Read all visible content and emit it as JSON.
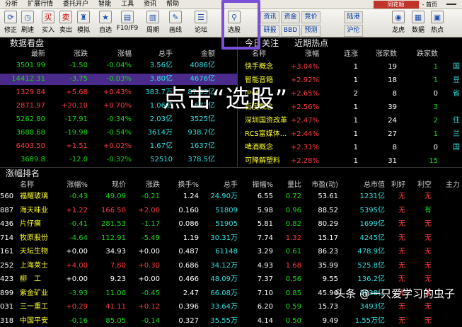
{
  "menu": {
    "items": [
      "分析",
      "扩展行情",
      "委托开户",
      "智能",
      "工具",
      "资讯",
      "帮助"
    ],
    "brand": "同花顺",
    "window_title": "- 首页"
  },
  "toolbar": {
    "buttons": [
      {
        "name": "refresh-button",
        "label": "修正",
        "icon": "⟳"
      },
      {
        "name": "clock-button",
        "label": "刷速",
        "icon": "◷"
      },
      {
        "name": "buy-button",
        "label": "买入",
        "icon": "买"
      },
      {
        "name": "sell-button",
        "label": "卖出",
        "icon": "卖"
      },
      {
        "name": "simulate-button",
        "label": "模拟",
        "icon": "♜"
      },
      {
        "name": "watchlist-button",
        "label": "自选",
        "icon": "★"
      },
      {
        "name": "f10-button",
        "label": "F10/F9",
        "icon": "▤"
      },
      {
        "name": "period-button",
        "label": "周期",
        "icon": "▥"
      },
      {
        "name": "drawline-button",
        "label": "画线",
        "icon": "✎"
      },
      {
        "name": "forum-button",
        "label": "论坛",
        "icon": "☰"
      },
      {
        "name": "stock-selector-button",
        "label": "选股",
        "icon": "⚲"
      },
      {
        "name": "longhu-button",
        "label": "龙虎",
        "icon": "◉"
      },
      {
        "name": "data-button",
        "label": "数据",
        "icon": "▦"
      },
      {
        "name": "hot-button",
        "label": "热点",
        "icon": "▣"
      }
    ],
    "grid_a": [
      "资讯",
      "资金",
      "竞价",
      "研报",
      "BBD",
      "预测"
    ],
    "grid_b": [
      "陆港",
      "沪伦"
    ]
  },
  "market": {
    "title": "数据看盘",
    "headers": [
      "最新",
      "涨跌",
      "涨幅",
      "总手",
      "金额"
    ],
    "rows": [
      {
        "cls": "dn",
        "v": [
          "3501.99",
          "-1.50",
          "-0.04%",
          "3.56亿",
          "4086亿"
        ]
      },
      {
        "cls": "dn",
        "v": [
          "14412.31",
          "-3.75",
          "-0.03%",
          "3.80亿",
          "4676亿"
        ]
      },
      {
        "cls": "up",
        "v": [
          "1329.84",
          "+5.68",
          "+0.43%",
          "383.7万",
          "87.93亿"
        ]
      },
      {
        "cls": "up",
        "v": [
          "2871.97",
          "+20.10",
          "+0.70%",
          "1.06亿",
          "1672亿"
        ]
      },
      {
        "cls": "dn",
        "v": [
          "5262.80",
          "-17.91",
          "-0.34%",
          "2.03亿",
          "3525亿"
        ]
      },
      {
        "cls": "dn",
        "v": [
          "3688.68",
          "-19.98",
          "-0.54%",
          "3614万",
          "938.7亿"
        ]
      },
      {
        "cls": "up",
        "v": [
          "6403.50",
          "+1.51",
          "+0.02%",
          "1.67亿",
          "1637亿"
        ]
      },
      {
        "cls": "dn",
        "v": [
          "3689.8",
          "-12.0",
          "-0.32%",
          "52510",
          "378.5亿"
        ]
      }
    ]
  },
  "hot": {
    "tabs": [
      "今日关注",
      "近期热点"
    ],
    "headers": [
      "名称",
      "涨幅",
      "连涨",
      "涨家数",
      "跌家数"
    ],
    "rows": [
      {
        "name": "快手概念",
        "chg": "+3.04%",
        "days": "1",
        "up": "19",
        "down": "1"
      },
      {
        "name": "智能音箱",
        "chg": "+2.92%",
        "days": "1",
        "up": "18",
        "down": "1"
      },
      {
        "name": "IPv6",
        "chg": "+2.65%",
        "days": "2",
        "up": "8",
        "down": "0"
      },
      {
        "name": "百度概念",
        "chg": "+2.56%",
        "days": "1",
        "up": "39",
        "down": "3"
      },
      {
        "name": "深圳国资改革",
        "chg": "+2.47%",
        "days": "1",
        "up": "24",
        "down": "2"
      },
      {
        "name": "RCS富媒体...",
        "chg": "+2.44%",
        "days": "1",
        "up": "27",
        "down": "1"
      },
      {
        "name": "啤酒概念",
        "chg": "+2.31%",
        "days": "1",
        "up": "8",
        "down": "0"
      },
      {
        "name": "可降解塑料",
        "chg": "+2.28%",
        "days": "1",
        "up": "31",
        "down": "15"
      }
    ],
    "edge": [
      "国",
      "豆",
      "省",
      "",
      "住",
      "兰",
      "国"
    ]
  },
  "rank": {
    "title": "涨幅排名",
    "headers": [
      "名称",
      "涨幅%",
      "现价",
      "涨跌",
      "换手%",
      "总手",
      "振幅%",
      "量比",
      "市盈(动)",
      "总市值",
      "利好",
      "利空",
      "主力"
    ],
    "rows": [
      {
        "code": "560",
        "name": "福耀玻璃",
        "chg": "-0.43",
        "price": "49.09",
        "diff": "-0.21",
        "turn": "1.24",
        "vol": "24.90万",
        "amp": "6.55",
        "vr": "0.72",
        "pe": "53.61",
        "cap": "1231亿",
        "good": "无",
        "bad": "无"
      },
      {
        "code": "887",
        "name": "海天味业",
        "chg": "+1.22",
        "price": "166.50",
        "diff": "+2.00",
        "turn": "0.160",
        "vol": "51809",
        "amp": "5.98",
        "vr": "0.96",
        "pe": "88.52",
        "cap": "5395亿",
        "good": "无",
        "bad": "有"
      },
      {
        "code": "436",
        "name": "片仔癀",
        "chg": "-0.41",
        "price": "281.53",
        "diff": "-1.17",
        "turn": "0.086",
        "vol": "51905",
        "amp": "5.81",
        "vr": "0.82",
        "pe": "80.29",
        "cap": "1699亿",
        "good": "无",
        "bad": "无"
      },
      {
        "code": "714",
        "name": "牧原股份",
        "chg": "-4.64",
        "price": "112.91",
        "diff": "-5.49",
        "turn": "1.19",
        "vol": "30.31万",
        "amp": "7.74",
        "vr": "1.32",
        "pe": "15.17",
        "cap": "4245亿",
        "good": "无",
        "bad": "无"
      },
      {
        "code": "161",
        "name": "天坛生物",
        "chg": "+0.00",
        "price": "34.93",
        "diff": "+0.00",
        "turn": "0.487",
        "vol": "61148",
        "amp": "3.29",
        "vr": "0.61",
        "pe": "86.23",
        "cap": "478.9亿",
        "good": "无",
        "bad": "无"
      },
      {
        "code": "252",
        "name": "上海莱士",
        "chg": "+4.00",
        "price": "7.80",
        "diff": "+0.30",
        "turn": "0.686",
        "vol": "34.12万",
        "amp": "4.93",
        "vr": "1.68",
        "pe": "35.99",
        "cap": "525.8亿",
        "good": "无",
        "bad": "无"
      },
      {
        "code": "423",
        "name": "柳　工",
        "chg": "+0.00",
        "price": "9.23",
        "diff": "+0.00",
        "turn": "0.466",
        "vol": "48.09万",
        "amp": "7.37",
        "vr": "0.56",
        "pe": "9.55",
        "cap": "136.2亿",
        "good": "无",
        "bad": "无"
      },
      {
        "code": "899",
        "name": "紫金矿业",
        "chg": "-3.93",
        "price": "11.00",
        "diff": "-0.45",
        "turn": "2.47",
        "vol": "66.08万",
        "amp": "7.10",
        "vr": "0.85",
        "pe": "45.96",
        "cap": "2838亿",
        "good": "无",
        "bad": "无"
      },
      {
        "code": "031",
        "name": "三一重工",
        "chg": "+0.29",
        "price": "41.11",
        "diff": "+0.12",
        "turn": "0.396",
        "vol": "33.64万",
        "amp": "6.20",
        "vr": "0.59",
        "pe": "15.73",
        "cap": "3493亿",
        "good": "无",
        "bad": "无"
      },
      {
        "code": "318",
        "name": "中国平安",
        "chg": "-0.16",
        "price": "85.05",
        "diff": "-0.14",
        "turn": "0.327",
        "vol": "35.55万",
        "amp": "4.14",
        "vr": "0.50",
        "pe": "9.49",
        "cap": "1.55万亿",
        "good": "无",
        "bad": "无"
      }
    ]
  },
  "overlay_text": "点击“选股”",
  "watermark": "头条 @一只爱学习的虫子"
}
